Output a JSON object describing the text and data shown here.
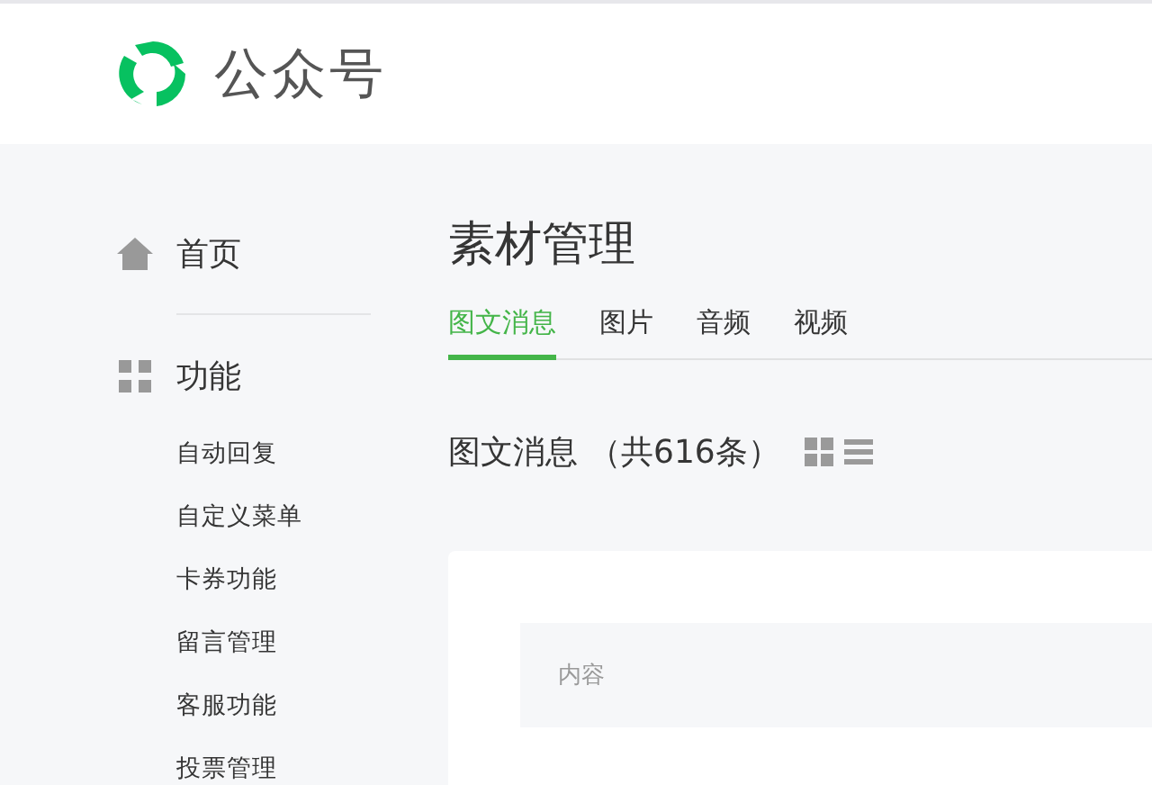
{
  "header": {
    "logo_text": "公众号"
  },
  "sidebar": {
    "sections": [
      {
        "kind": "home",
        "label": "首页"
      },
      {
        "kind": "grid",
        "label": "功能",
        "items": [
          "自动回复",
          "自定义菜单",
          "卡券功能",
          "留言管理",
          "客服功能",
          "投票管理"
        ]
      }
    ]
  },
  "main": {
    "title": "素材管理",
    "tabs": [
      {
        "label": "图文消息",
        "selected": true
      },
      {
        "label": "图片",
        "selected": false
      },
      {
        "label": "音频",
        "selected": false
      },
      {
        "label": "视频",
        "selected": false
      }
    ],
    "section_heading": "图文消息",
    "count": "（共616条）",
    "table": {
      "columns": [
        "内容"
      ]
    }
  }
}
